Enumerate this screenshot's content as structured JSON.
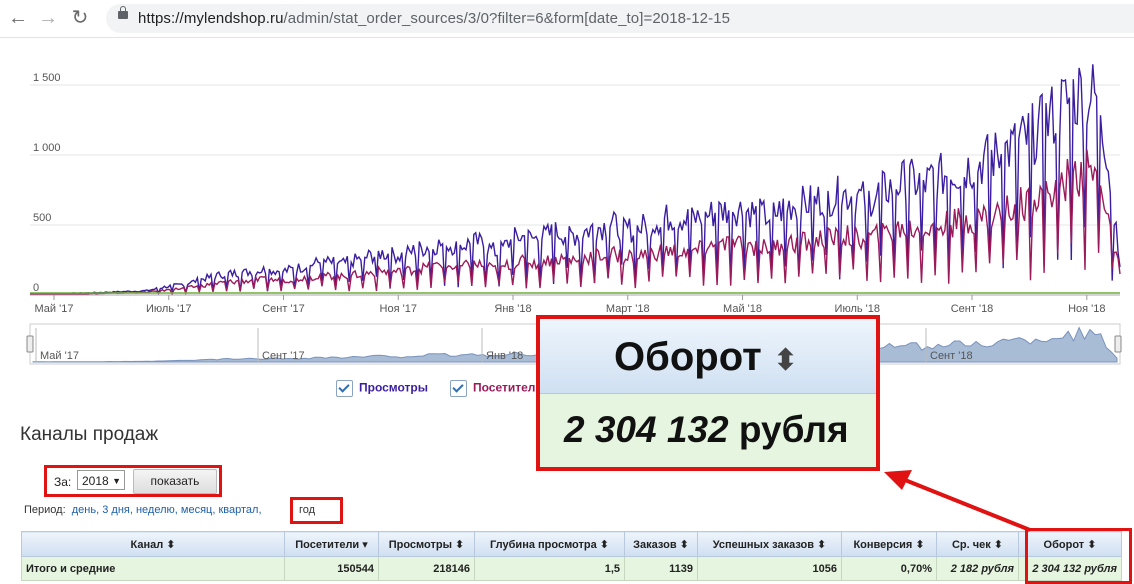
{
  "browser": {
    "url_host": "https://mylendshop.ru",
    "url_path": "/admin/stat_order_sources/3/0?filter=6&form[date_to]=2018-12-15"
  },
  "chart_data": {
    "type": "line",
    "y_ticks": [
      "1 500",
      "1 000",
      "500",
      "0"
    ],
    "ylim": [
      0,
      1550
    ],
    "x_ticks": [
      "Май '17",
      "Июль '17",
      "Сент '17",
      "Ноя '17",
      "Янв '18",
      "Март '18",
      "Май '18",
      "Июль '18",
      "Сент '18",
      "Ноя '18"
    ],
    "navigator_ticks": [
      "Май '17",
      "Сент '17",
      "Янв '18",
      "Сент '18"
    ],
    "series": [
      {
        "name": "Просмотры",
        "color": "#3b1ea0",
        "values": [
          10,
          8,
          12,
          15,
          20,
          25,
          30,
          60,
          80,
          120,
          150,
          160,
          180,
          170,
          200,
          240,
          220,
          260,
          300,
          280,
          330,
          360,
          350,
          380,
          300,
          420,
          400,
          450,
          430,
          480,
          500,
          460,
          520,
          560,
          540,
          580,
          620,
          600,
          560,
          640,
          660,
          700,
          720,
          680,
          760,
          820,
          800,
          860,
          900,
          960,
          1020,
          1100,
          1200,
          1350,
          1450,
          1400,
          200
        ]
      },
      {
        "name": "Посетители",
        "color": "#9a1a5a",
        "values": [
          5,
          5,
          8,
          10,
          12,
          15,
          20,
          35,
          50,
          70,
          90,
          100,
          110,
          105,
          120,
          140,
          130,
          150,
          170,
          165,
          190,
          210,
          200,
          220,
          180,
          240,
          230,
          260,
          250,
          280,
          290,
          270,
          300,
          320,
          310,
          340,
          360,
          350,
          330,
          370,
          380,
          400,
          420,
          400,
          440,
          480,
          470,
          500,
          530,
          560,
          600,
          650,
          720,
          800,
          880,
          850,
          150
        ]
      }
    ],
    "legend": [
      "Просмотры",
      "Посетители"
    ]
  },
  "section_title": "Каналы продаж",
  "filter": {
    "label": "За:",
    "year": "2018",
    "button": "показать"
  },
  "period": {
    "label": "Период:",
    "links": [
      "день,",
      "3 дня,",
      "неделю,",
      "месяц,",
      "квартал,"
    ],
    "active": "год"
  },
  "table": {
    "headers": [
      "Канал ⬍",
      "Посетители ▾",
      "Просмотры ⬍",
      "Глубина просмотра ⬍",
      "Заказов ⬍",
      "Успешных заказов ⬍",
      "Конверсия ⬍",
      "Ср. чек ⬍",
      "Оборот ⬍"
    ],
    "total_row": [
      "Итого и средние",
      "150544",
      "218146",
      "1,5",
      "1139",
      "1056",
      "0,70%",
      "2 182 рубля",
      "2 304 132 рубля"
    ]
  },
  "popup": {
    "header": "Оборот",
    "sort_icon": "⬍",
    "value_num": "2 304 132",
    "value_unit": "рубля"
  },
  "colors": {
    "highlight": "#e01212",
    "views": "#3b1ea0",
    "visitors": "#9a1a5a",
    "green_series": "#6fae3a"
  }
}
